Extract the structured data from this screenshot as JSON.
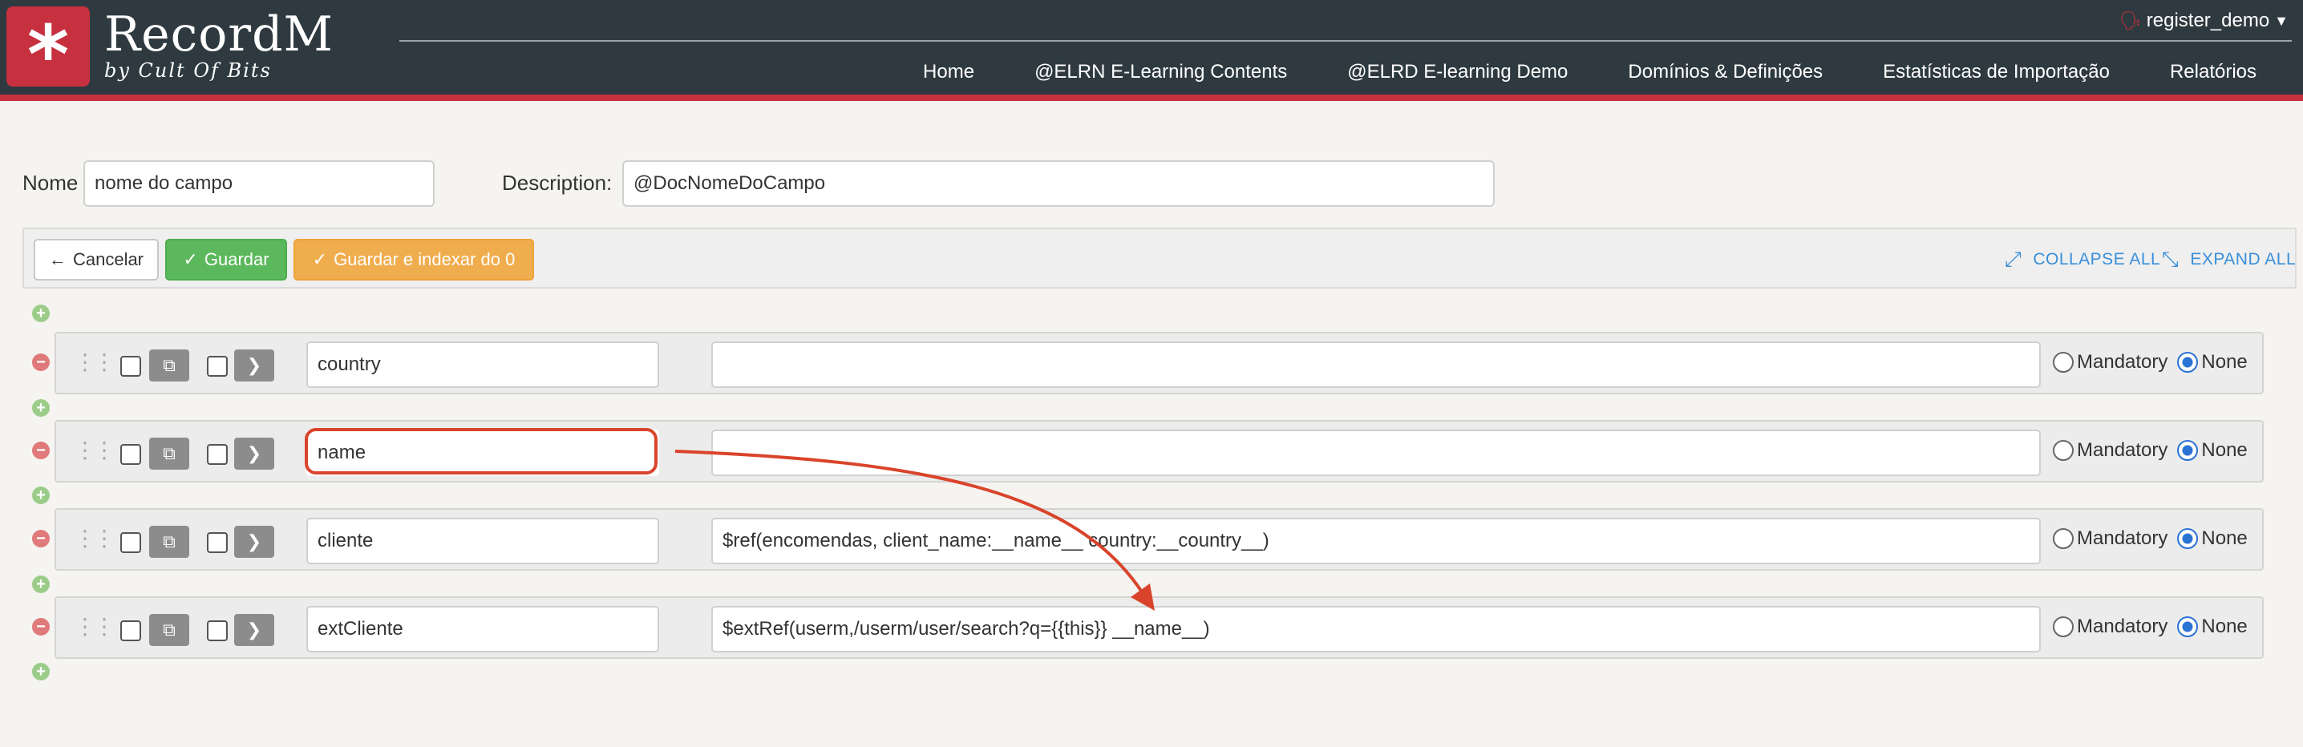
{
  "app": {
    "title": "RecordM",
    "subtitle": "by Cult Of Bits",
    "user": "register_demo"
  },
  "nav": [
    "Home",
    "@ELRN E-Learning Contents",
    "@ELRD E-learning Demo",
    "Domínios & Definições",
    "Estatísticas de Importação",
    "Relatórios"
  ],
  "form": {
    "name_label": "Nome",
    "name_value": "nome do campo",
    "description_label": "Description:",
    "description_value": "@DocNomeDoCampo"
  },
  "toolbar": {
    "cancel": "Cancelar",
    "save": "Guardar",
    "save_index": "Guardar e indexar do 0",
    "collapse_all": "COLLAPSE ALL",
    "expand_all": "EXPAND ALL"
  },
  "fields": [
    {
      "name": "country",
      "description": "",
      "option_mandatory": "Mandatory",
      "option_none": "None",
      "selected": "None"
    },
    {
      "name": "name",
      "description": "",
      "option_mandatory": "Mandatory",
      "option_none": "None",
      "selected": "None"
    },
    {
      "name": "cliente",
      "description": "$ref(encomendas, client_name:__name__ country:__country__)",
      "option_mandatory": "Mandatory",
      "option_none": "None",
      "selected": "None"
    },
    {
      "name": "extCliente",
      "description": "$extRef(userm,/userm/user/search?q={{this}} __name__)",
      "option_mandatory": "Mandatory",
      "option_none": "None",
      "selected": "None"
    }
  ],
  "icons": {
    "logo": "asterisk-icon",
    "user": "person-icon",
    "cancel": "arrow-left-icon",
    "save": "check-icon",
    "collapse": "compress-icon",
    "expand": "expand-icon",
    "duplicate": "copy-icon",
    "open": "chevron-right-icon",
    "drag": "drag-handle-icon",
    "add": "plus-circle-icon",
    "remove": "minus-circle-icon"
  },
  "colors": {
    "header_bg": "#2e3a3f",
    "brand_red": "#c7303f",
    "save_green": "#5cb85c",
    "index_orange": "#f0ad4e",
    "link_blue": "#3a8fd9",
    "annotation_red": "#d9442b"
  }
}
